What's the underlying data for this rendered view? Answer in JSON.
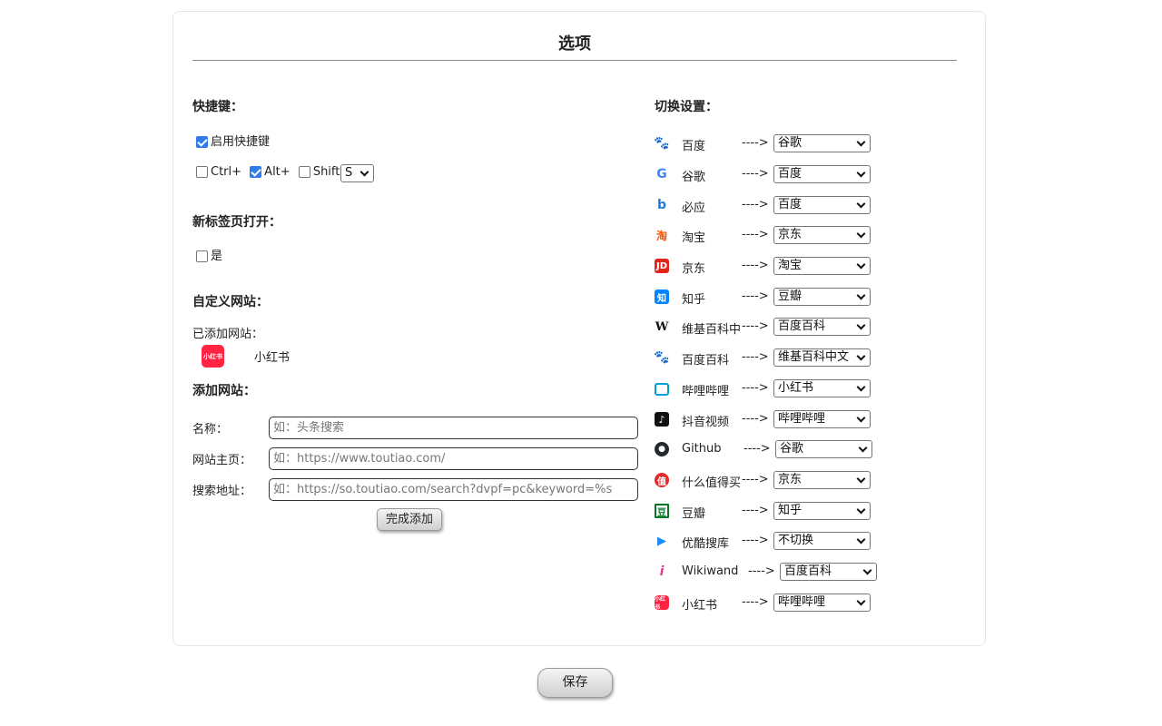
{
  "page": {
    "title": "选项"
  },
  "shortcut": {
    "heading": "快捷键：",
    "enable_label": "启用快捷键",
    "enable_checked": true,
    "ctrl_label": "Ctrl+",
    "ctrl_checked": false,
    "alt_label": "Alt+",
    "alt_checked": true,
    "shift_label": "Shift+",
    "shift_checked": false,
    "key_value": "S"
  },
  "new_tab": {
    "heading": "新标签页打开：",
    "yes_label": "是",
    "yes_checked": false
  },
  "custom": {
    "heading": "自定义网站：",
    "added_label": "已添加网站：",
    "added_sites": [
      {
        "name": "小红书",
        "icon": "xiaohongshu-icon",
        "color": "#ff2442"
      }
    ],
    "add_heading": "添加网站：",
    "name_label": "名称：",
    "name_placeholder": "如：头条搜索",
    "home_label": "网站主页：",
    "home_placeholder": "如：https://www.toutiao.com/",
    "search_label": "搜索地址：",
    "search_placeholder": "如：https://so.toutiao.com/search?dvpf=pc&keyword=%s",
    "submit_label": "完成添加"
  },
  "switch": {
    "heading": "切换设置：",
    "arrow": "---->",
    "rows": [
      {
        "name": "百度",
        "icon": "baidu-icon",
        "target": "谷歌"
      },
      {
        "name": "谷歌",
        "icon": "google-icon",
        "target": "百度"
      },
      {
        "name": "必应",
        "icon": "bing-icon",
        "target": "百度"
      },
      {
        "name": "淘宝",
        "icon": "taobao-icon",
        "target": "京东"
      },
      {
        "name": "京东",
        "icon": "jd-icon",
        "target": "淘宝"
      },
      {
        "name": "知乎",
        "icon": "zhihu-icon",
        "target": "豆瓣"
      },
      {
        "name": "维基百科中",
        "icon": "wikipedia-icon",
        "target": "百度百科"
      },
      {
        "name": "百度百科",
        "icon": "baidu-baike-icon",
        "target": "维基百科中文"
      },
      {
        "name": "哔哩哔哩",
        "icon": "bilibili-icon",
        "target": "小红书"
      },
      {
        "name": "抖音视频",
        "icon": "douyin-icon",
        "target": "哔哩哔哩"
      },
      {
        "name": "Github",
        "icon": "github-icon",
        "target": "谷歌"
      },
      {
        "name": "什么值得买",
        "icon": "smzdm-icon",
        "target": "京东"
      },
      {
        "name": "豆瓣",
        "icon": "douban-icon",
        "target": "知乎"
      },
      {
        "name": "优酷搜库",
        "icon": "youku-icon",
        "target": "不切换"
      },
      {
        "name": "Wikiwand",
        "icon": "wikiwand-icon",
        "target": "百度百科"
      },
      {
        "name": "小红书",
        "icon": "xiaohongshu-icon",
        "target": "哔哩哔哩"
      }
    ]
  },
  "footer": {
    "save_label": "保存"
  },
  "colors": {
    "accent": "#2f7bea",
    "baidu": "#2932e1",
    "jd": "#e1251b",
    "zhihu": "#0084ff",
    "xiaohongshu": "#ff2442"
  }
}
